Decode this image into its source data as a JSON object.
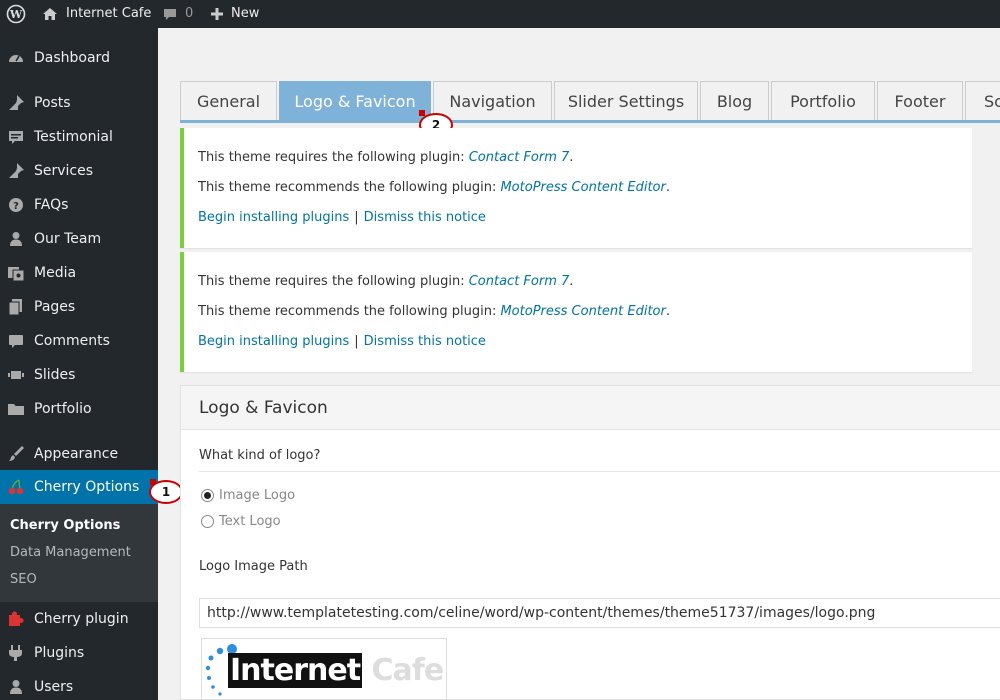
{
  "adminbar": {
    "site_name": "Internet Cafe",
    "comments_count": "0",
    "new_label": "New"
  },
  "sidebar": {
    "items": [
      {
        "label": "Dashboard",
        "icon": "dashboard-icon"
      },
      {
        "label": "Posts",
        "icon": "pin-icon"
      },
      {
        "label": "Testimonial",
        "icon": "comment-icon"
      },
      {
        "label": "Services",
        "icon": "pin-icon"
      },
      {
        "label": "FAQs",
        "icon": "help-icon"
      },
      {
        "label": "Our Team",
        "icon": "user-icon"
      },
      {
        "label": "Media",
        "icon": "media-icon"
      },
      {
        "label": "Pages",
        "icon": "pages-icon"
      },
      {
        "label": "Comments",
        "icon": "comment-icon"
      },
      {
        "label": "Slides",
        "icon": "slides-icon"
      },
      {
        "label": "Portfolio",
        "icon": "folder-icon"
      },
      {
        "label": "Appearance",
        "icon": "brush-icon"
      },
      {
        "label": "Cherry Options",
        "icon": "cherry-icon"
      },
      {
        "label": "Cherry plugin",
        "icon": "puzzle-icon"
      },
      {
        "label": "Plugins",
        "icon": "plug-icon"
      },
      {
        "label": "Users",
        "icon": "user-icon"
      }
    ],
    "submenu": [
      "Cherry Options",
      "Data Management",
      "SEO"
    ]
  },
  "tabs": [
    "General",
    "Logo & Favicon",
    "Navigation",
    "Slider Settings",
    "Blog",
    "Portfolio",
    "Footer",
    "Sc"
  ],
  "active_tab": "Logo & Favicon",
  "notices": [
    {
      "requires_text": "This theme requires the following plugin: ",
      "requires_plugin": "Contact Form 7",
      "recommends_text": "This theme recommends the following plugin: ",
      "recommends_plugin": "MotoPress Content Editor",
      "period": ".",
      "install_link": "Begin installing plugins",
      "separator": "|",
      "dismiss_link": "Dismiss this notice"
    },
    {
      "requires_text": "This theme requires the following plugin: ",
      "requires_plugin": "Contact Form 7",
      "recommends_text": "This theme recommends the following plugin: ",
      "recommends_plugin": "MotoPress Content Editor",
      "period": ".",
      "install_link": "Begin installing plugins",
      "separator": "|",
      "dismiss_link": "Dismiss this notice"
    }
  ],
  "panel": {
    "title": "Logo & Favicon",
    "logo_kind_label": "What kind of logo?",
    "options": [
      "Image Logo",
      "Text Logo"
    ],
    "selected_option": "Image Logo",
    "path_label": "Logo Image Path",
    "path_value": "http://www.templatetesting.com/celine/word/wp-content/themes/theme51737/images/logo.png",
    "logo_preview_text_dark": "Internet",
    "logo_preview_text_light": "Cafe"
  },
  "callouts": [
    "1",
    "2"
  ],
  "colors": {
    "adminbar_bg": "#23282d",
    "active_menu": "#0073aa",
    "active_tab": "#7fb2d9",
    "notice_border": "#7ad03a",
    "link": "#0073aa",
    "callout_border": "#cc0000"
  }
}
